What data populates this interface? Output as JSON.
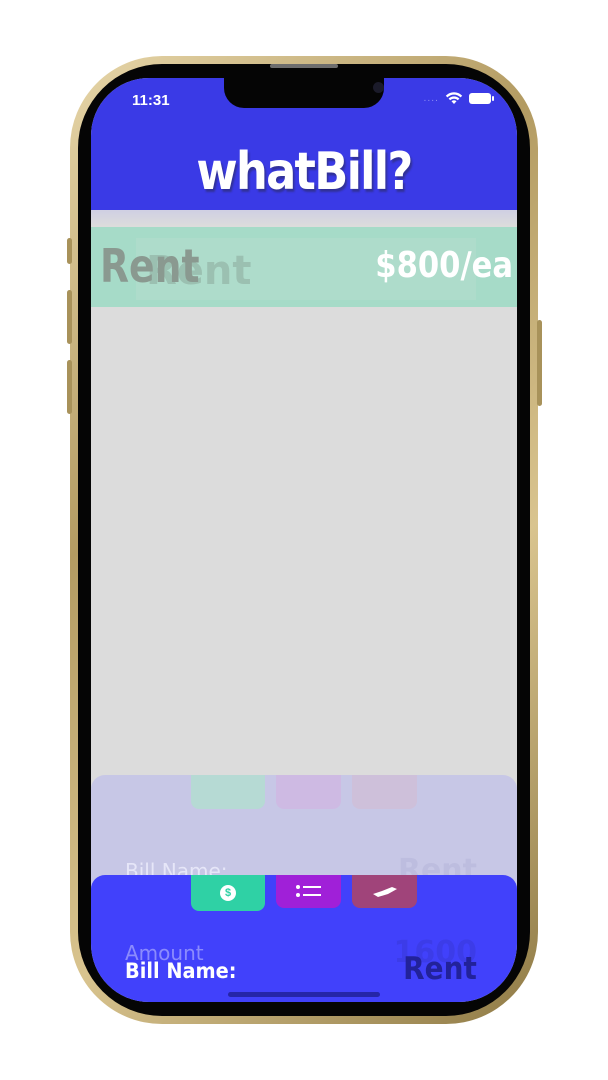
{
  "status_bar": {
    "time": "11:31",
    "signal_dots": "....",
    "wifi_icon": "wifi-icon",
    "battery_icon": "battery-icon"
  },
  "header": {
    "title": "whatBill?"
  },
  "bill_list": [
    {
      "name": "Rent",
      "ghost_name": "Rent",
      "amount": "$800/ea",
      "color": "#a6dbc8"
    }
  ],
  "bottom_sheet_ghost": {
    "label_name": "Bill Name:",
    "value_name": "Rent"
  },
  "bottom_sheet": {
    "toolbar": [
      {
        "icon": "money-icon",
        "color": "#2fd1a5"
      },
      {
        "icon": "list-icon",
        "color": "#a020d8"
      },
      {
        "icon": "hand-icon",
        "color": "#a0447a"
      }
    ],
    "label_amount": "Amount",
    "value_amount": "1600",
    "label_name": "Bill Name:",
    "value_name": "Rent"
  },
  "colors": {
    "header_blue": "#3a3ae6",
    "sheet_blue": "#4141fb",
    "background_gray": "#dcdcdc"
  }
}
